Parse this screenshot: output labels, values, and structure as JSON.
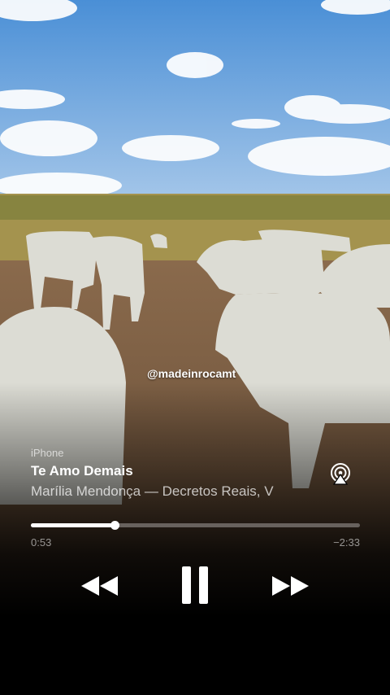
{
  "video": {
    "watermark": "@madeinrocamt"
  },
  "player": {
    "source": "iPhone",
    "title": "Te Amo Demais",
    "artist": "Marília Mendonça — Decretos Reais, V",
    "elapsed": "0:53",
    "remaining": "−2:33",
    "progress": 0.255,
    "icons": {
      "airplay": "airplay-icon",
      "rewind": "rewind-icon",
      "pause": "pause-icon",
      "fast_forward": "fast-forward-icon"
    }
  }
}
